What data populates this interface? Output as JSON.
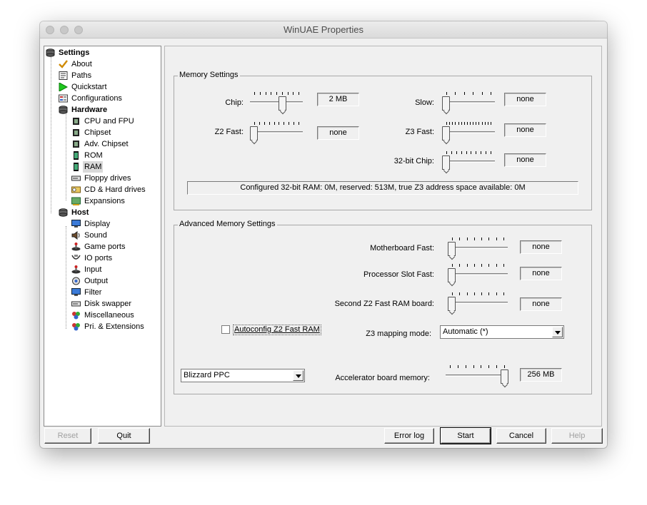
{
  "window": {
    "title": "WinUAE Properties"
  },
  "tree": {
    "items": [
      {
        "label": "Settings",
        "icon": "settings-disk-icon"
      },
      {
        "label": "About",
        "icon": "checkmark-icon"
      },
      {
        "label": "Paths",
        "icon": "paths-document-icon"
      },
      {
        "label": "Quickstart",
        "icon": "play-arrow-icon"
      },
      {
        "label": "Configurations",
        "icon": "configurations-icon"
      },
      {
        "label": "Hardware",
        "icon": "hardware-disk-icon"
      },
      {
        "label": "CPU and FPU",
        "icon": "chip-icon"
      },
      {
        "label": "Chipset",
        "icon": "chip-icon"
      },
      {
        "label": "Adv. Chipset",
        "icon": "chip-icon"
      },
      {
        "label": "ROM",
        "icon": "memory-chip-icon"
      },
      {
        "label": "RAM",
        "icon": "memory-chip-icon"
      },
      {
        "label": "Floppy drives",
        "icon": "floppy-drive-icon"
      },
      {
        "label": "CD & Hard drives",
        "icon": "hard-drive-icon"
      },
      {
        "label": "Expansions",
        "icon": "expansion-card-icon"
      },
      {
        "label": "Host",
        "icon": "host-disk-icon"
      },
      {
        "label": "Display",
        "icon": "monitor-icon"
      },
      {
        "label": "Sound",
        "icon": "sound-icon"
      },
      {
        "label": "Game ports",
        "icon": "joystick-icon"
      },
      {
        "label": "IO ports",
        "icon": "io-ports-icon"
      },
      {
        "label": "Input",
        "icon": "input-joystick-icon"
      },
      {
        "label": "Output",
        "icon": "output-icon"
      },
      {
        "label": "Filter",
        "icon": "filter-monitor-icon"
      },
      {
        "label": "Disk swapper",
        "icon": "disk-swapper-icon"
      },
      {
        "label": "Miscellaneous",
        "icon": "miscellaneous-icon"
      },
      {
        "label": "Pri. & Extensions",
        "icon": "extensions-icon"
      }
    ]
  },
  "memory": {
    "group_label": "Memory Settings",
    "chip": {
      "label": "Chip:",
      "value": "2 MB",
      "level": 0.63
    },
    "slow": {
      "label": "Slow:",
      "value": "none",
      "level": 0
    },
    "z2fast": {
      "label": "Z2 Fast:",
      "value": "none",
      "level": 0
    },
    "z3fast": {
      "label": "Z3 Fast:",
      "value": "none",
      "level": 0
    },
    "chip32": {
      "label": "32-bit Chip:",
      "value": "none",
      "level": 0
    },
    "status": "Configured 32-bit RAM: 0M, reserved: 513M, true Z3 address space available: 0M"
  },
  "advanced": {
    "group_label": "Advanced Memory Settings",
    "mbfast": {
      "label": "Motherboard Fast:",
      "value": "none",
      "level": 0
    },
    "procslot": {
      "label": "Processor Slot Fast:",
      "value": "none",
      "level": 0
    },
    "secondz2": {
      "label": "Second Z2 Fast RAM board:",
      "value": "none",
      "level": 0
    },
    "autoconfig_label": "Autoconfig Z2 Fast RAM",
    "autoconfig_checked": false,
    "z3map": {
      "label": "Z3 mapping mode:",
      "value": "Automatic (*)"
    },
    "accel_board": "Blizzard PPC",
    "accel_mem": {
      "label": "Accelerator board memory:",
      "value": "256 MB",
      "level": 1.0
    }
  },
  "buttons": {
    "reset": "Reset",
    "quit": "Quit",
    "errorlog": "Error log",
    "start": "Start",
    "cancel": "Cancel",
    "help": "Help"
  }
}
